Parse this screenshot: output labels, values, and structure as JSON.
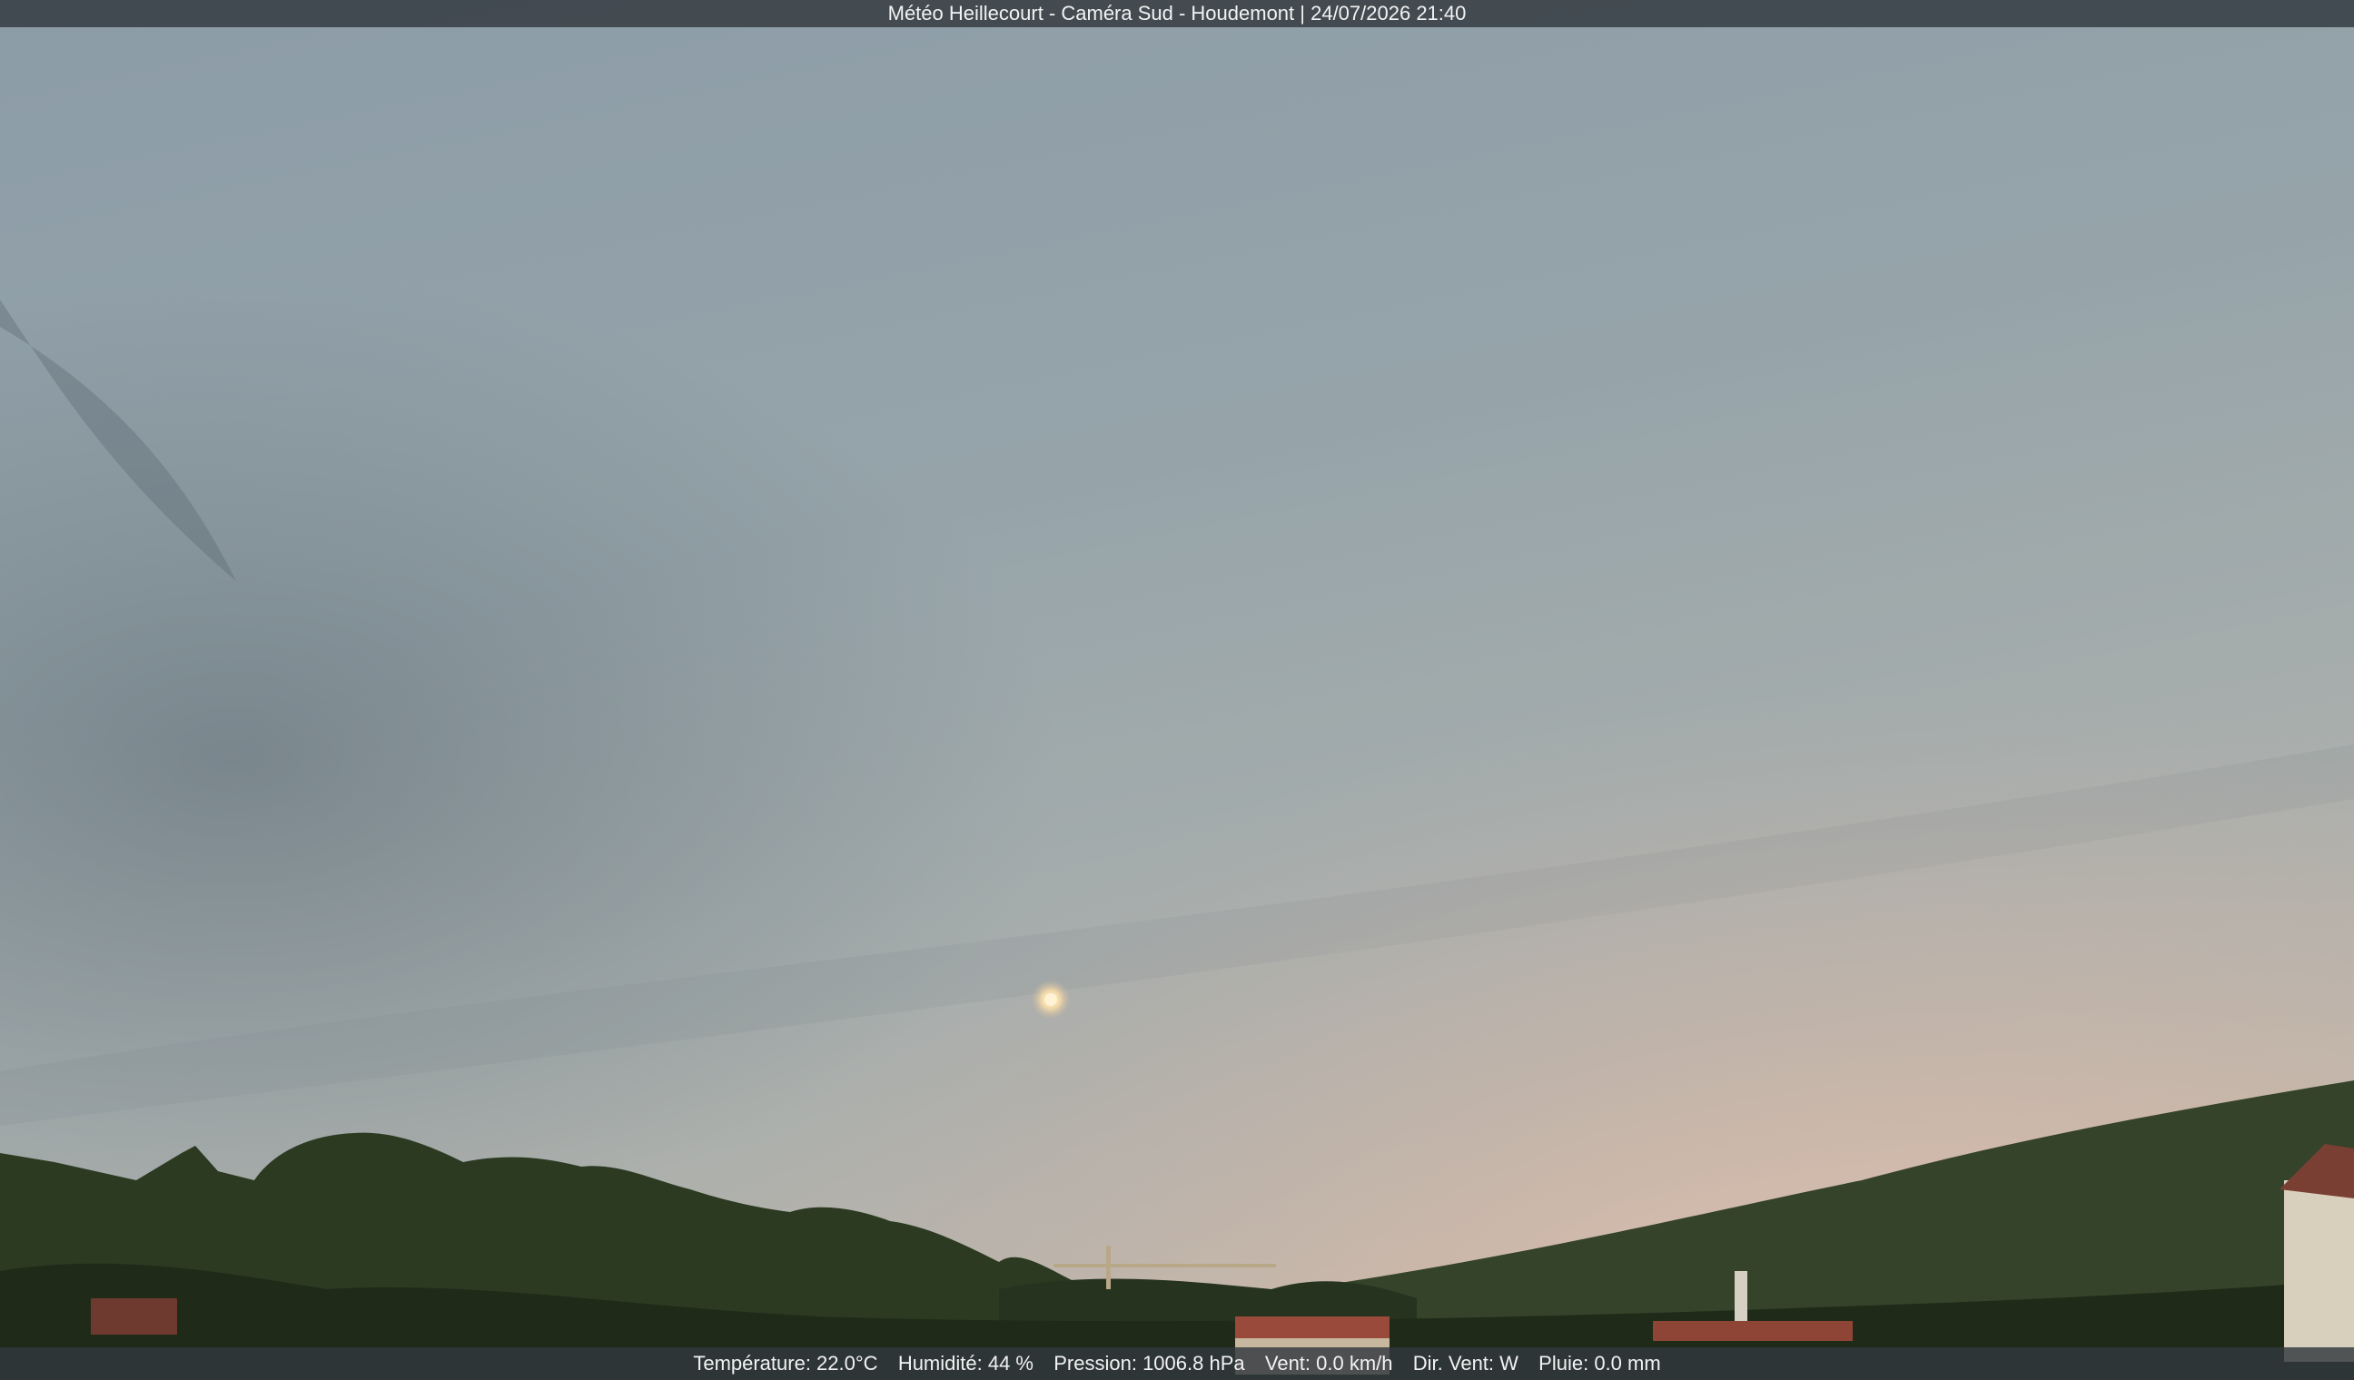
{
  "overlay": {
    "title": "Météo Heillecourt - Caméra Sud - Houdemont | 24/07/2026 21:40",
    "readings": [
      "Température: 22.0°C",
      "Humidité: 44 %",
      "Pression: 1006.8 hPa",
      "Vent: 0.0 km/h",
      "Dir. Vent: W",
      "Pluie: 0.0 mm"
    ]
  },
  "colors": {
    "sky_top": "#8c9ca7",
    "sky_mid": "#a4adae",
    "horizon_glow": "#e3c3b2",
    "vegetation": "#2e3e25",
    "roofs": "#9a4a3a",
    "bar_bg": "#32383e",
    "bar_text": "#f2f2f2"
  },
  "icons": [
    "moon-icon"
  ]
}
